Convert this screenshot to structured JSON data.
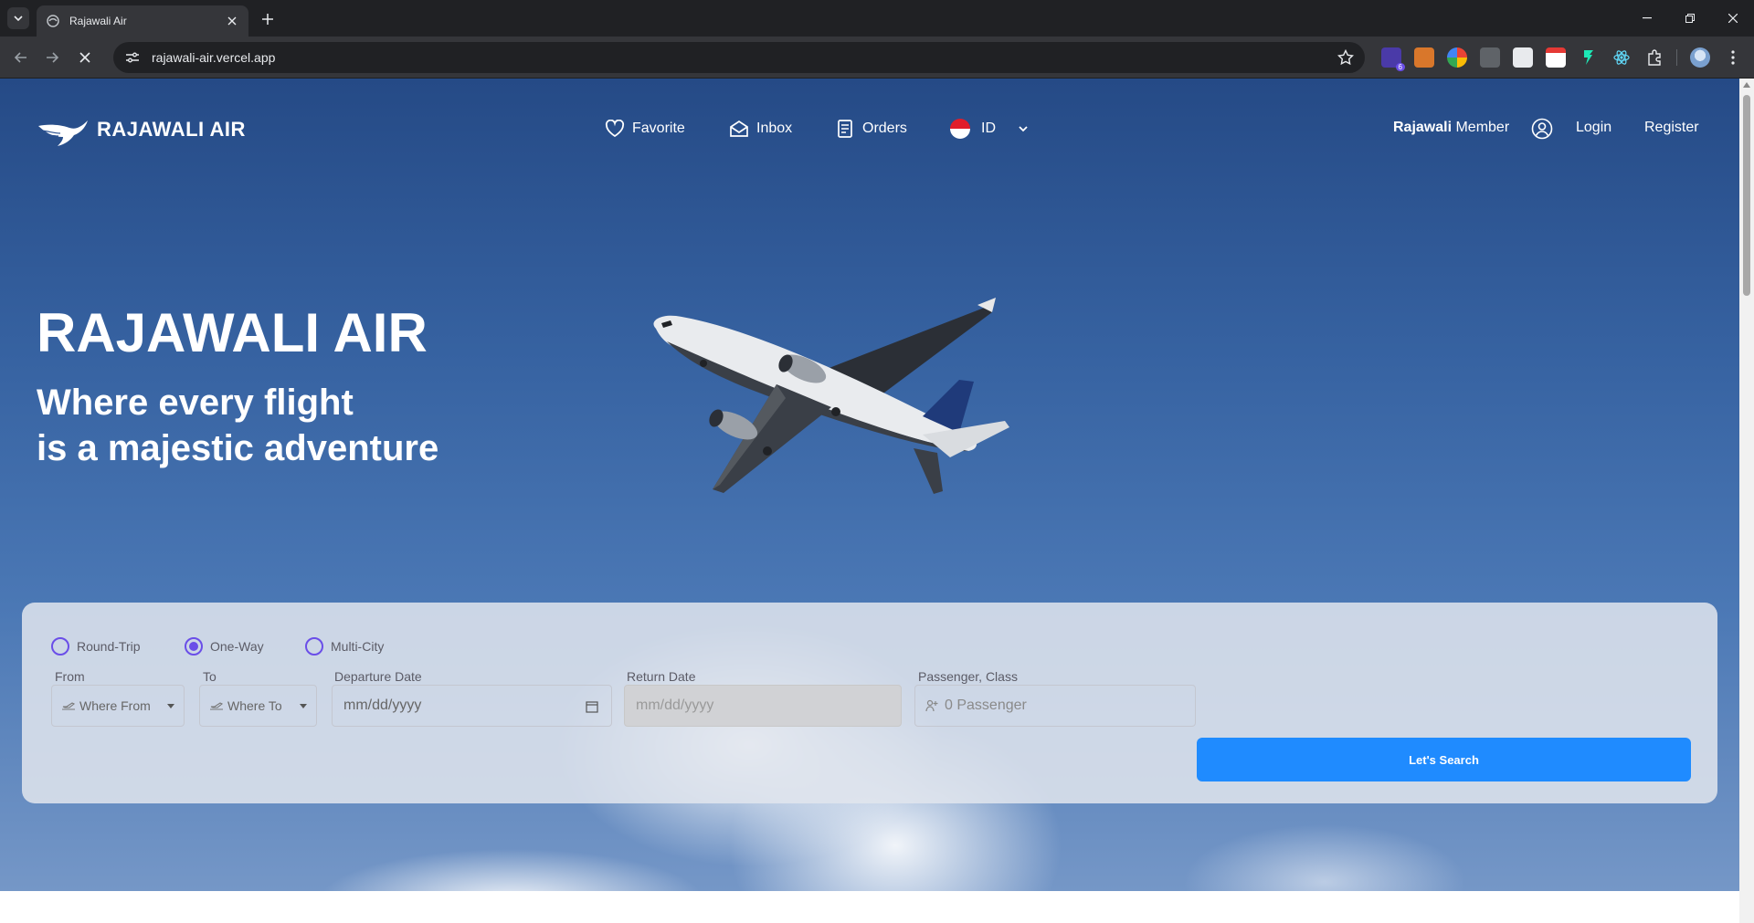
{
  "browser": {
    "tab_title": "Rajawali Air",
    "url": "rajawali-air.vercel.app",
    "extension_badge": "6"
  },
  "site": {
    "brand": "RAJAWALI AIR",
    "nav": {
      "favorite": "Favorite",
      "inbox": "Inbox",
      "orders": "Orders",
      "language": "ID"
    },
    "member_bold": "Rajawali",
    "member_rest": " Member",
    "login": "Login",
    "register": "Register"
  },
  "hero": {
    "title": "RAJAWALI AIR",
    "subtitle_line1": "Where every flight",
    "subtitle_line2": "is a majestic adventure"
  },
  "search": {
    "trip_types": [
      {
        "label": "Round-Trip",
        "selected": false
      },
      {
        "label": "One-Way",
        "selected": true
      },
      {
        "label": "Multi-City",
        "selected": false
      }
    ],
    "from_label": "From",
    "from_placeholder": "Where From",
    "to_label": "To",
    "to_placeholder": "Where To",
    "departure_label": "Departure Date",
    "departure_placeholder": "mm/dd/yyyy",
    "return_label": "Return Date",
    "return_placeholder": "mm/dd/yyyy",
    "passenger_label": "Passenger, Class",
    "passenger_placeholder": "0 Passenger",
    "submit_label": "Let's Search"
  },
  "colors": {
    "accent": "#1f8bff",
    "radio": "#6a4ee8",
    "flag_red": "#e11d2a"
  }
}
